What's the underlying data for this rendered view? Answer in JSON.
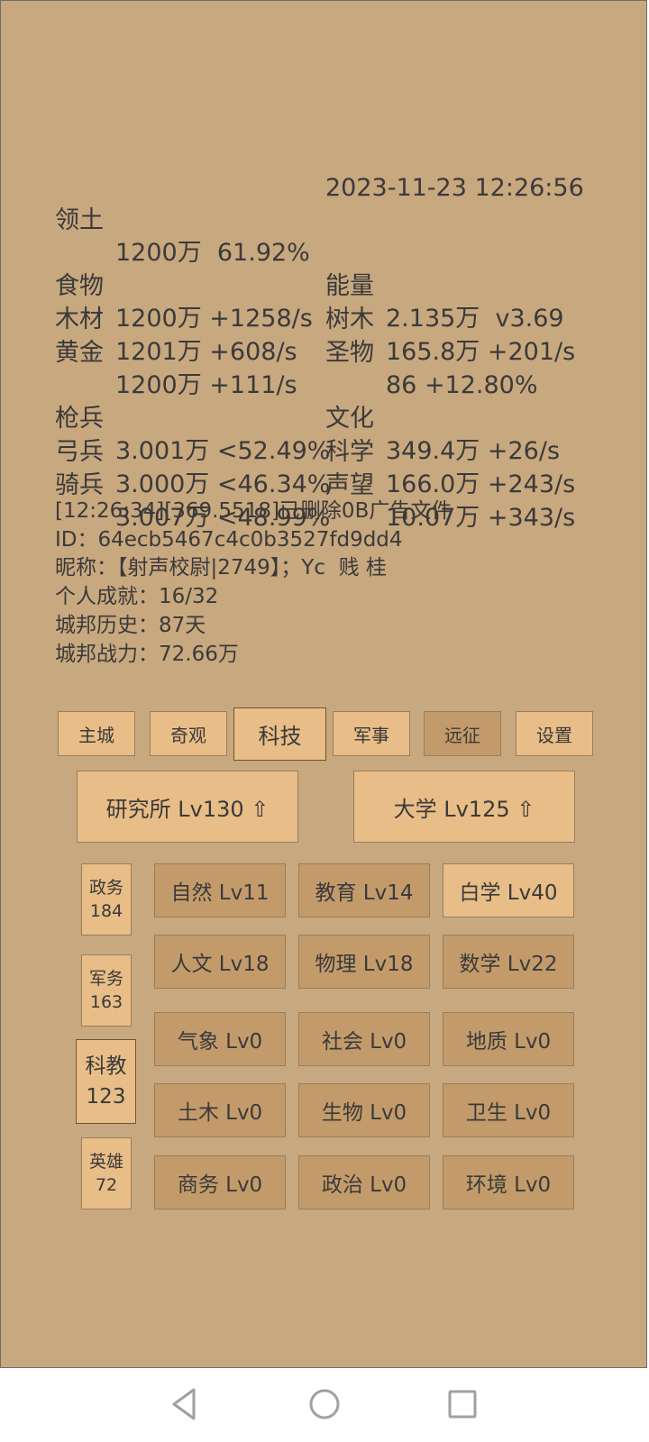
{
  "stats": {
    "territory": {
      "label": "领土",
      "value": "1200万  61.92%"
    },
    "datetime": "2023-11-23 12:26:56",
    "resources_left": [
      {
        "label": "食物",
        "value": "1200万 +1258/s"
      },
      {
        "label": "木材",
        "value": "1201万 +608/s"
      },
      {
        "label": "黄金",
        "value": "1200万 +111/s"
      }
    ],
    "resources_right": [
      {
        "label": "能量",
        "value": "2.135万  v3.69"
      },
      {
        "label": "树木",
        "value": "165.8万 +201/s"
      },
      {
        "label": "圣物",
        "value": "86 +12.80%"
      }
    ],
    "troops_left": [
      {
        "label": "枪兵",
        "value": "3.001万 <52.49%"
      },
      {
        "label": "弓兵",
        "value": "3.000万 <46.34%"
      },
      {
        "label": "骑兵",
        "value": "3.007万 <48.99%"
      }
    ],
    "troops_right": [
      {
        "label": "文化",
        "value": "349.4万 +26/s"
      },
      {
        "label": "科学",
        "value": "166.0万 +243/s"
      },
      {
        "label": "声望",
        "value": "10.07万 +343/s"
      }
    ]
  },
  "log": {
    "message": "[12:26:34][369.5518]已删除0B广告文件",
    "id": "ID：64ecb5467c4c0b3527fd9dd4",
    "nickname": "昵称：【射声校尉|2749】；Yc  贱 桂",
    "achievements": "个人成就：16/32",
    "history": "城邦历史：87天",
    "power": "城邦战力：72.66万"
  },
  "tabs": [
    "主城",
    "奇观",
    "科技",
    "军事",
    "远征",
    "设置"
  ],
  "selected_tab": "科技",
  "buildings": [
    "研究所 Lv130 ⇧",
    "大学 Lv125 ⇧"
  ],
  "categories": [
    {
      "name": "政务",
      "count": "184"
    },
    {
      "name": "军务",
      "count": "163"
    },
    {
      "name": "科教",
      "count": "123"
    },
    {
      "name": "英雄",
      "count": "72"
    }
  ],
  "selected_category": "科教",
  "techs": [
    "自然 Lv11",
    "教育 Lv14",
    "白学 Lv40",
    "人文 Lv18",
    "物理 Lv18",
    "数学 Lv22",
    "气象 Lv0",
    "社会 Lv0",
    "地质 Lv0",
    "土木 Lv0",
    "生物 Lv0",
    "卫生 Lv0",
    "商务 Lv0",
    "政治 Lv0",
    "环境 Lv0"
  ],
  "colors": {
    "background": "#c8a87f",
    "button_light": "#e8bd87",
    "button_dark": "#c39b6b"
  },
  "navbar": {
    "back": "back-icon",
    "home": "home-icon",
    "recents": "recents-icon"
  }
}
